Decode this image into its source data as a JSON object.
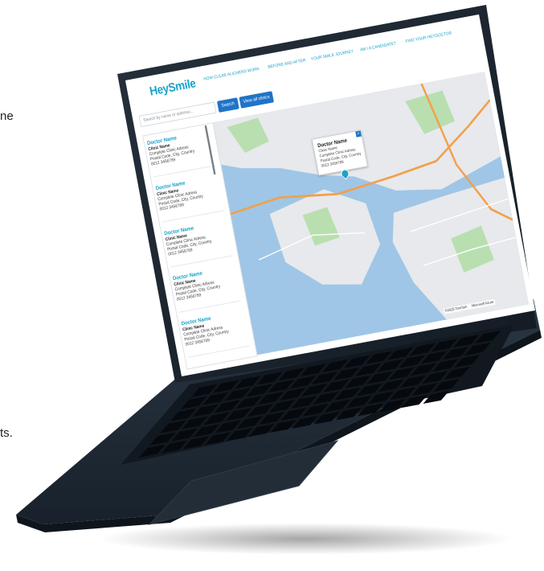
{
  "page": {
    "side_text_1": "ne",
    "side_text_2": "ts."
  },
  "site": {
    "logo": "HeySmile",
    "logo_sub": "",
    "nav": [
      "HOW CLEAR ALIGNERS WORK",
      "BEFORE AND AFTER",
      "YOUR SMILE JOURNEY",
      "AM I A CANDIDATE?",
      "FIND YOUR HEYDOCTOR"
    ]
  },
  "search": {
    "placeholder": "Search by name or address...",
    "search_label": "Search",
    "view_all_label": "View all clinics"
  },
  "clinics": [
    {
      "doctor": "Doctor Name",
      "clinic": "Clinic Name",
      "address": "Complete Clinic Adress",
      "city": "Postal Code, City, Country",
      "phone": "0012 3456789"
    },
    {
      "doctor": "Doctor Name",
      "clinic": "Clinic Name",
      "address": "Complete Clinic Adress",
      "city": "Postal Code, City, Country",
      "phone": "0012 3456789"
    },
    {
      "doctor": "Doctor Name",
      "clinic": "Clinic Name",
      "address": "Complete Clinic Adress",
      "city": "Postal Code, City, Country",
      "phone": "0012 3456789"
    },
    {
      "doctor": "Doctor Name",
      "clinic": "Clinic Name",
      "address": "Complete Clinic Adress",
      "city": "Postal Code, City, Country",
      "phone": "0012 3456789"
    },
    {
      "doctor": "Doctor Name",
      "clinic": "Clinic Name",
      "address": "Complete Clinic Adress",
      "city": "Postal Code, City, Country",
      "phone": "0012 3456789"
    }
  ],
  "popup": {
    "doctor": "Doctor Name",
    "clinic": "Clinic Name",
    "address": "Complete Clinic Adress",
    "city": "Postal Code, City, Country",
    "phone": "0012 3456789"
  },
  "map": {
    "attribution": "©2025 TomTom",
    "provider": "Microsoft Azure",
    "colors": {
      "land": "#e7e9ec",
      "water": "#9fc6e6",
      "park": "#b9dfb0",
      "highway": "#f2a04a"
    }
  },
  "colors": {
    "accent": "#1aa3c9",
    "button": "#1f73c9",
    "laptop_body": "#1c2733"
  }
}
